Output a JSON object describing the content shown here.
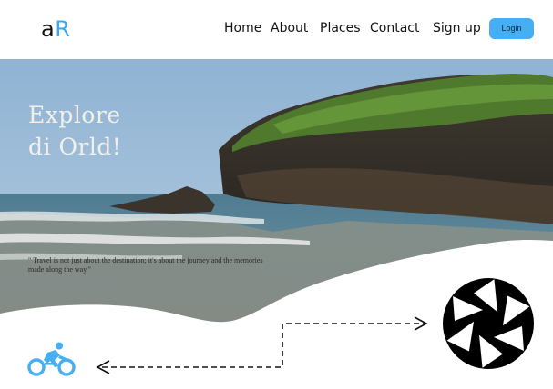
{
  "brand": {
    "logo_a": "a",
    "logo_r": "R",
    "accent_color": "#3aa8ef"
  },
  "nav": {
    "home": "Home",
    "about": "About",
    "places": "Places",
    "contact": "Contact",
    "signup": "Sign up",
    "login": "Login"
  },
  "hero": {
    "title_line1": "Explore",
    "title_line2": "di Orld!",
    "quote": "\" Travel is not just about the destination; it's about the journey and the memories made along the way.\""
  },
  "icons": {
    "camera": "camera-shutter-icon",
    "bike": "cyclist-icon",
    "arrow_right": "dashed-arrow-right-icon",
    "arrow_left": "dashed-arrow-left-icon"
  },
  "colors": {
    "button": "#46aef2",
    "cyclist": "#46aef2",
    "shutter": "#000000"
  }
}
